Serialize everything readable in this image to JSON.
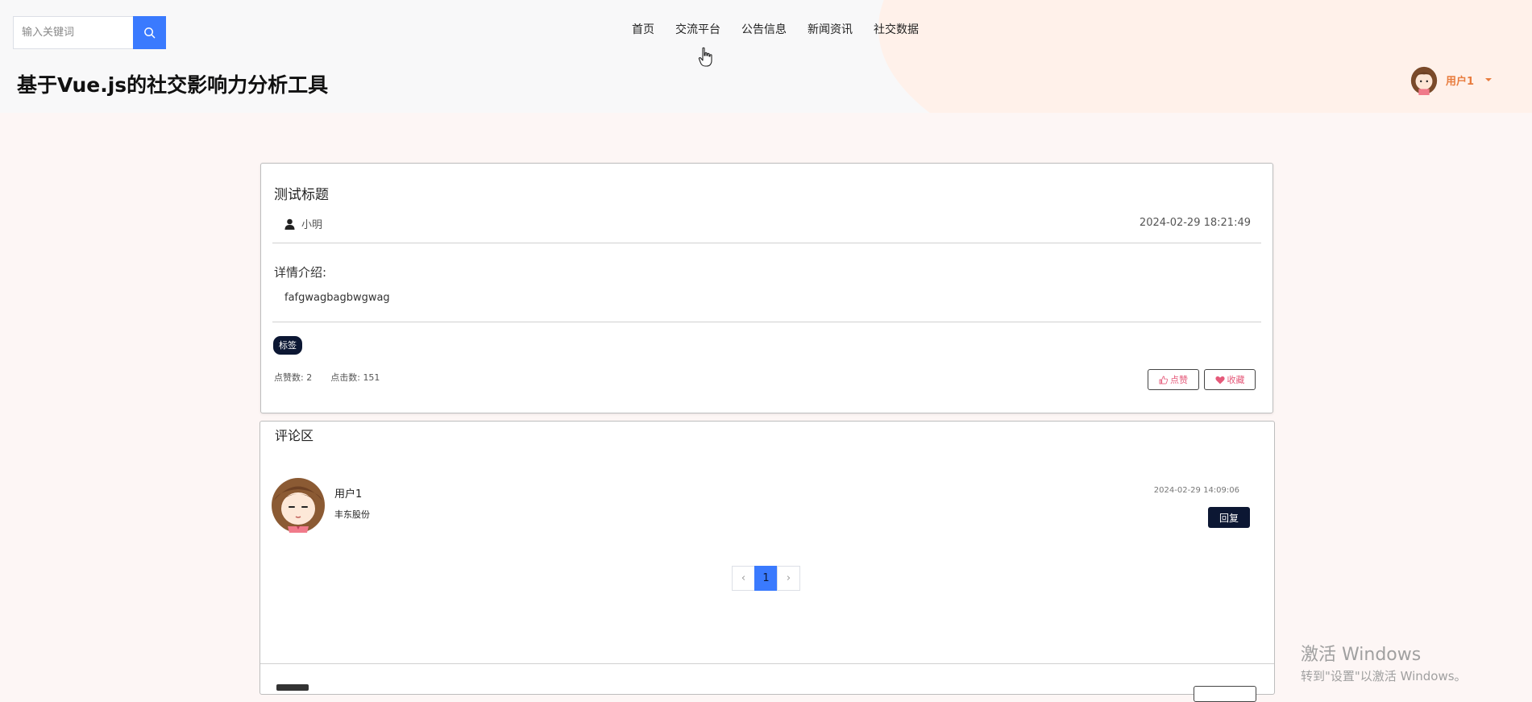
{
  "header": {
    "search": {
      "placeholder": "输入关键词",
      "value": ""
    },
    "site_title": "基于Vue.js的社交影响力分析工具",
    "nav": [
      "首页",
      "交流平台",
      "公告信息",
      "新闻资讯",
      "社交数据"
    ],
    "user": {
      "name": "用户1"
    }
  },
  "post": {
    "title": "测试标题",
    "author": "小明",
    "time": "2024-02-29 18:21:49",
    "detail_label": "详情介绍:",
    "detail_content": "fafgwagbagbwgwag",
    "tag": "标签",
    "likes_label": "点赞数:",
    "likes_value": "2",
    "clicks_label": "点击数:",
    "clicks_value": "151",
    "like_button": "点赞",
    "favorite_button": "收藏"
  },
  "comments": {
    "heading": "评论区",
    "items": [
      {
        "user": "用户1",
        "text": "丰东股份",
        "time": "2024-02-29 14:09:06",
        "reply_label": "回复"
      }
    ],
    "pagination": {
      "prev": "‹",
      "current": "1",
      "next": "›"
    }
  },
  "watermark": {
    "title": "激活 Windows",
    "subtitle": "转到\"设置\"以激活 Windows。"
  },
  "colors": {
    "accent": "#3a7afe",
    "dark": "#0c1733",
    "user_name": "#e87c3e",
    "action_text": "#e55a7a"
  }
}
